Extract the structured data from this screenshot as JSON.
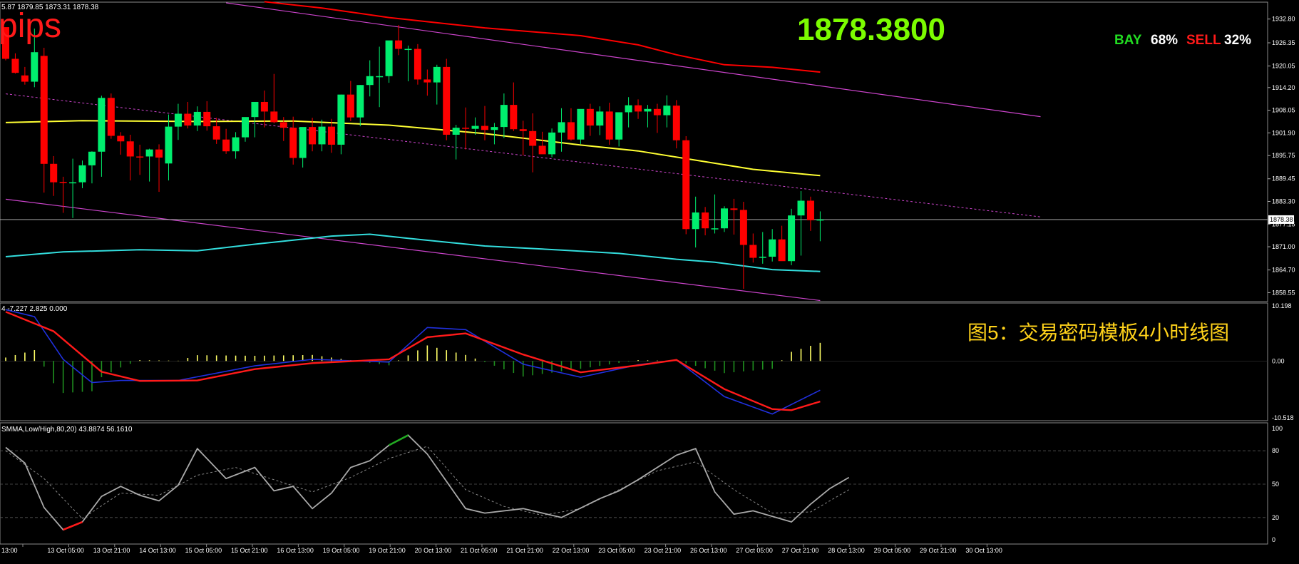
{
  "header": {
    "ohlc_text": "5.87 1879.85 1873.31 1878.38",
    "pips_label": "pips",
    "current_price": "1878.3800",
    "bay_label": "BAY",
    "bay_percent": "68%",
    "sell_label": "SELL",
    "sell_percent": "32%"
  },
  "annotation": {
    "caption": "图5：交易密码模板4小时线图"
  },
  "colors": {
    "background": "#000000",
    "bull": "#00ee6e",
    "bear": "#ff0000",
    "ma_yellow": "#ffff33",
    "lower_band": "#33dddd",
    "channel": "#cc44cc",
    "macd_red": "#ff1a1a",
    "macd_blue": "#2030dd",
    "hist_pos": "#ffff66",
    "hist_neg": "#1f8f1f",
    "price_green": "#7cfc00",
    "stoch_main": "#aaaaaa"
  },
  "chart_data": [
    {
      "type": "candlestick",
      "panel": "price",
      "ylim": [
        1856.5,
        1937.0
      ],
      "yticks": [
        "1932.80",
        "1926.35",
        "1920.05",
        "1914.20",
        "1908.05",
        "1901.90",
        "1895.75",
        "1889.45",
        "1883.30",
        "1877.15",
        "1871.00",
        "1864.70",
        "1858.55"
      ],
      "current_price_tag": "1878.38",
      "current_price": 1878.38,
      "candles": [
        [
          1930.6,
          1924.9,
          1921.6,
          1922.0
        ],
        [
          1922.0,
          1923.5,
          1918.0,
          1918.2
        ],
        [
          1917.5,
          1919.8,
          1915.0,
          1915.8
        ],
        [
          1915.8,
          1930.2,
          1914.3,
          1923.8
        ],
        [
          1922.8,
          1925.0,
          1885.7,
          1893.5
        ],
        [
          1893.5,
          1895.6,
          1884.8,
          1888.5
        ],
        [
          1888.6,
          1890.0,
          1880.2,
          1888.5
        ],
        [
          1888.5,
          1894.9,
          1878.8,
          1888.5
        ],
        [
          1888.5,
          1894.4,
          1886.9,
          1893.1
        ],
        [
          1893.1,
          1896.9,
          1888.2,
          1896.8
        ],
        [
          1896.8,
          1912.0,
          1890.0,
          1911.4
        ],
        [
          1911.4,
          1912.6,
          1900.3,
          1901.1
        ],
        [
          1901.1,
          1902.1,
          1896.0,
          1899.6
        ],
        [
          1899.6,
          1901.4,
          1889.0,
          1895.5
        ],
        [
          1895.5,
          1898.7,
          1890.5,
          1895.4
        ],
        [
          1895.5,
          1897.6,
          1888.7,
          1897.4
        ],
        [
          1897.4,
          1898.8,
          1885.9,
          1895.2
        ],
        [
          1893.6,
          1906.9,
          1889.0,
          1903.6
        ],
        [
          1903.6,
          1909.8,
          1900.0,
          1907.1
        ],
        [
          1907.1,
          1910.3,
          1903.1,
          1903.9
        ],
        [
          1903.9,
          1909.1,
          1902.4,
          1907.6
        ],
        [
          1907.6,
          1910.5,
          1902.5,
          1903.7
        ],
        [
          1903.7,
          1906.0,
          1898.9,
          1900.1
        ],
        [
          1900.1,
          1903.0,
          1896.2,
          1896.9
        ],
        [
          1896.9,
          1902.1,
          1894.9,
          1900.7
        ],
        [
          1900.7,
          1905.7,
          1899.5,
          1906.2
        ],
        [
          1906.2,
          1910.2,
          1900.7,
          1910.3
        ],
        [
          1910.3,
          1913.4,
          1903.4,
          1907.7
        ],
        [
          1907.7,
          1917.9,
          1904.5,
          1904.8
        ],
        [
          1904.8,
          1906.2,
          1899.7,
          1903.3
        ],
        [
          1903.3,
          1906.3,
          1893.3,
          1895.1
        ],
        [
          1895.1,
          1903.2,
          1892.5,
          1903.5
        ],
        [
          1903.5,
          1906.0,
          1896.9,
          1898.8
        ],
        [
          1898.8,
          1905.5,
          1896.9,
          1903.6
        ],
        [
          1903.6,
          1905.7,
          1896.5,
          1898.7
        ],
        [
          1898.7,
          1912.3,
          1896.1,
          1912.3
        ],
        [
          1912.3,
          1916.0,
          1905.1,
          1906.1
        ],
        [
          1906.1,
          1914.9,
          1903.7,
          1914.9
        ],
        [
          1914.9,
          1921.6,
          1911.8,
          1917.3
        ],
        [
          1917.3,
          1925.3,
          1908.9,
          1917.3
        ],
        [
          1917.3,
          1926.9,
          1915.5,
          1927.0
        ],
        [
          1927.0,
          1931.2,
          1923.0,
          1924.7
        ],
        [
          1924.7,
          1925.6,
          1915.9,
          1924.7
        ],
        [
          1924.7,
          1926.0,
          1915.0,
          1916.4
        ],
        [
          1916.4,
          1919.1,
          1912.0,
          1915.6
        ],
        [
          1915.6,
          1920.4,
          1909.6,
          1919.8
        ],
        [
          1919.8,
          1922.0,
          1899.9,
          1901.4
        ],
        [
          1901.4,
          1904.1,
          1894.7,
          1903.3
        ],
        [
          1903.3,
          1908.8,
          1897.4,
          1903.0
        ],
        [
          1903.0,
          1906.1,
          1901.4,
          1903.8
        ],
        [
          1903.8,
          1909.2,
          1899.9,
          1902.7
        ],
        [
          1902.7,
          1904.6,
          1898.8,
          1903.5
        ],
        [
          1903.5,
          1912.6,
          1900.5,
          1909.5
        ],
        [
          1909.5,
          1915.6,
          1902.4,
          1902.9
        ],
        [
          1902.9,
          1905.2,
          1895.8,
          1902.4
        ],
        [
          1902.4,
          1907.2,
          1891.2,
          1898.4
        ],
        [
          1898.4,
          1902.2,
          1896.9,
          1896.1
        ],
        [
          1896.1,
          1903.1,
          1895.3,
          1902.0
        ],
        [
          1902.0,
          1908.6,
          1896.8,
          1904.8
        ],
        [
          1904.8,
          1908.6,
          1899.8,
          1900.1
        ],
        [
          1900.1,
          1904.5,
          1898.9,
          1908.4
        ],
        [
          1908.4,
          1909.8,
          1901.1,
          1903.9
        ],
        [
          1903.9,
          1909.1,
          1901.3,
          1907.7
        ],
        [
          1907.7,
          1910.1,
          1898.7,
          1900.1
        ],
        [
          1900.1,
          1907.2,
          1898.2,
          1907.5
        ],
        [
          1907.5,
          1911.6,
          1903.4,
          1909.4
        ],
        [
          1909.4,
          1911.0,
          1905.7,
          1907.7
        ],
        [
          1907.7,
          1909.5,
          1903.4,
          1908.4
        ],
        [
          1908.4,
          1909.8,
          1901.9,
          1906.7
        ],
        [
          1906.7,
          1912.1,
          1903.4,
          1909.3
        ],
        [
          1909.3,
          1910.8,
          1897.7,
          1899.9
        ],
        [
          1899.9,
          1901.0,
          1874.4,
          1875.8
        ],
        [
          1875.8,
          1884.6,
          1870.8,
          1880.3
        ],
        [
          1880.3,
          1881.8,
          1874.1,
          1876.0
        ],
        [
          1876.0,
          1885.2,
          1874.6,
          1876.0
        ],
        [
          1876.0,
          1882.0,
          1875.0,
          1881.4
        ],
        [
          1881.4,
          1884.0,
          1874.3,
          1881.0
        ],
        [
          1881.0,
          1883.2,
          1859.6,
          1871.5
        ],
        [
          1871.5,
          1874.6,
          1866.7,
          1868.0
        ],
        [
          1868.0,
          1875.0,
          1866.4,
          1868.3
        ],
        [
          1868.3,
          1875.8,
          1867.0,
          1873.0
        ],
        [
          1873.0,
          1876.7,
          1868.3,
          1867.1
        ],
        [
          1867.1,
          1881.3,
          1866.0,
          1879.5
        ],
        [
          1879.5,
          1886.1,
          1868.6,
          1883.5
        ],
        [
          1883.5,
          1884.6,
          1875.3,
          1878.2
        ],
        [
          1878.2,
          1880.6,
          1872.5,
          1878.4
        ]
      ],
      "ma_line": [
        [
          0,
          1904.7
        ],
        [
          8,
          1905.2
        ],
        [
          20,
          1905.0
        ],
        [
          30,
          1905.1
        ],
        [
          40,
          1904.0
        ],
        [
          50,
          1901.7
        ],
        [
          60,
          1898.6
        ],
        [
          66,
          1897.0
        ],
        [
          72,
          1894.5
        ],
        [
          78,
          1892.0
        ],
        [
          85,
          1890.3
        ]
      ],
      "red_band": [
        [
          27,
          1937.5
        ],
        [
          33,
          1935.8
        ],
        [
          40,
          1933.2
        ],
        [
          50,
          1930.4
        ],
        [
          60,
          1928.3
        ],
        [
          66,
          1925.8
        ],
        [
          70,
          1923.1
        ],
        [
          75,
          1920.4
        ],
        [
          80,
          1919.7
        ],
        [
          85,
          1918.4
        ]
      ],
      "cyan_band": [
        [
          0,
          1868.3
        ],
        [
          6,
          1869.6
        ],
        [
          14,
          1870.2
        ],
        [
          20,
          1869.9
        ],
        [
          26,
          1871.7
        ],
        [
          34,
          1873.9
        ],
        [
          38,
          1874.4
        ],
        [
          42,
          1873.3
        ],
        [
          50,
          1871.2
        ],
        [
          58,
          1870.1
        ],
        [
          64,
          1869.2
        ],
        [
          70,
          1867.6
        ],
        [
          74,
          1866.8
        ],
        [
          80,
          1864.8
        ],
        [
          85,
          1864.3
        ]
      ],
      "channel_upper": [
        [
          23,
          1937.2
        ],
        [
          108,
          1906.3
        ]
      ],
      "channel_lower": [
        [
          0,
          1883.9
        ],
        [
          85,
          1856.4
        ]
      ],
      "channel_middle": [
        [
          0,
          1912.5
        ],
        [
          108,
          1879.1
        ]
      ]
    },
    {
      "type": "macd",
      "panel": "oscillator",
      "header": "4 -7.227 2.825 0.000",
      "ylim": [
        -10.518,
        10.198
      ],
      "yticks": [
        "10.198",
        "0.00",
        "-10.518"
      ],
      "signal": [
        [
          0,
          9.1
        ],
        [
          5,
          5.5
        ],
        [
          10,
          -2.0
        ],
        [
          14,
          -3.7
        ],
        [
          20,
          -3.6
        ],
        [
          26,
          -1.5
        ],
        [
          32,
          -0.4
        ],
        [
          40,
          0.3
        ],
        [
          44,
          4.4
        ],
        [
          48,
          5.1
        ],
        [
          54,
          1.2
        ],
        [
          60,
          -2.1
        ],
        [
          66,
          -0.8
        ],
        [
          70,
          0.2
        ],
        [
          75,
          -5.2
        ],
        [
          80,
          -8.9
        ],
        [
          82,
          -9.1
        ],
        [
          85,
          -7.5
        ]
      ],
      "main": [
        [
          0,
          9.5
        ],
        [
          3,
          8.2
        ],
        [
          6,
          0.3
        ],
        [
          9,
          -4.0
        ],
        [
          12,
          -3.6
        ],
        [
          18,
          -3.6
        ],
        [
          26,
          -0.9
        ],
        [
          32,
          0.3
        ],
        [
          40,
          -0.2
        ],
        [
          44,
          6.2
        ],
        [
          48,
          5.8
        ],
        [
          54,
          -0.6
        ],
        [
          60,
          -3.0
        ],
        [
          66,
          -0.7
        ],
        [
          70,
          0.2
        ],
        [
          75,
          -6.6
        ],
        [
          80,
          -9.8
        ],
        [
          85,
          -5.4
        ]
      ]
    },
    {
      "type": "stochastic",
      "panel": "stochastic",
      "header": "SMMA,Low/High,80,20) 43.8874 56.1610",
      "ylim": [
        0,
        100
      ],
      "yticks": [
        "100",
        "80",
        "50",
        "20",
        "0"
      ],
      "levels": [
        80,
        50,
        20
      ],
      "main": [
        [
          0,
          83
        ],
        [
          2,
          69
        ],
        [
          4,
          29
        ],
        [
          6,
          9
        ],
        [
          8,
          16
        ],
        [
          10,
          39
        ],
        [
          12,
          48
        ],
        [
          14,
          40
        ],
        [
          16,
          35
        ],
        [
          18,
          49
        ],
        [
          20,
          82
        ],
        [
          23,
          55
        ],
        [
          26,
          65
        ],
        [
          28,
          44
        ],
        [
          30,
          48
        ],
        [
          32,
          28
        ],
        [
          34,
          42
        ],
        [
          36,
          65
        ],
        [
          38,
          71
        ],
        [
          40,
          85
        ],
        [
          42,
          94
        ],
        [
          44,
          77
        ],
        [
          48,
          28
        ],
        [
          50,
          24
        ],
        [
          54,
          28
        ],
        [
          58,
          20
        ],
        [
          62,
          37
        ],
        [
          64,
          44
        ],
        [
          66,
          54
        ],
        [
          70,
          76
        ],
        [
          72,
          82
        ],
        [
          74,
          43
        ],
        [
          76,
          23
        ],
        [
          78,
          26
        ],
        [
          82,
          16
        ],
        [
          84,
          32
        ],
        [
          86,
          46
        ],
        [
          88,
          56
        ]
      ],
      "signal": [
        [
          0,
          80
        ],
        [
          4,
          55
        ],
        [
          8,
          19
        ],
        [
          12,
          42
        ],
        [
          16,
          40
        ],
        [
          20,
          58
        ],
        [
          24,
          65
        ],
        [
          28,
          54
        ],
        [
          32,
          43
        ],
        [
          36,
          56
        ],
        [
          40,
          73
        ],
        [
          44,
          84
        ],
        [
          48,
          45
        ],
        [
          52,
          30
        ],
        [
          56,
          22
        ],
        [
          60,
          28
        ],
        [
          64,
          45
        ],
        [
          68,
          62
        ],
        [
          72,
          70
        ],
        [
          76,
          45
        ],
        [
          80,
          24
        ],
        [
          84,
          25
        ],
        [
          88,
          45
        ]
      ]
    }
  ],
  "xaxis": {
    "labels": [
      "13:00",
      "13 Oct 05:00",
      "13 Oct 21:00",
      "14 Oct 13:00",
      "15 Oct 05:00",
      "15 Oct 21:00",
      "16 Oct 13:00",
      "19 Oct 05:00",
      "19 Oct 21:00",
      "20 Oct 13:00",
      "21 Oct 05:00",
      "21 Oct 21:00",
      "22 Oct 13:00",
      "23 Oct 05:00",
      "23 Oct 21:00",
      "26 Oct 13:00",
      "27 Oct 05:00",
      "27 Oct 21:00",
      "28 Oct 13:00",
      "29 Oct 05:00",
      "29 Oct 21:00",
      "30 Oct 13:00"
    ]
  }
}
